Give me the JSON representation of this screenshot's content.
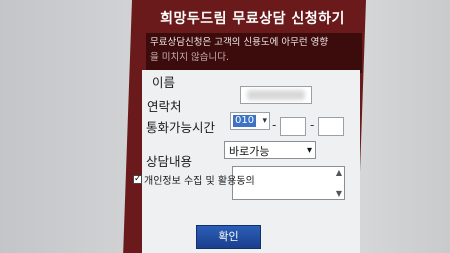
{
  "form": {
    "title": "희망두드림 무료상담 신청하기",
    "notice_line1": "무료상담신청은 고객의 신용도에 아무런 영향",
    "notice_line2": "을 미치지 않습니다.",
    "labels": {
      "name": "이름",
      "phone": "연락처",
      "available_time": "통화가능시간",
      "consult_content": "상담내용"
    },
    "phone_prefix": "010",
    "dash": "-",
    "available_time_value": "바로가능",
    "consent_label": "개인정보 수집 및 활용동의",
    "checkbox_mark": "✓",
    "confirm_label": "확인"
  },
  "colors": {
    "header_red": "#6a1a1a",
    "button_blue": "#2b5fb7"
  }
}
